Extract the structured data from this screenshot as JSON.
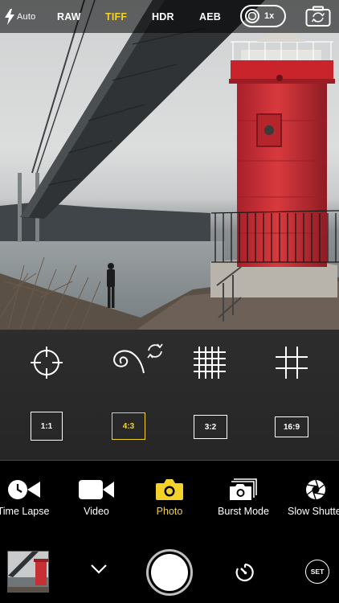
{
  "colors": {
    "accent": "#f3d22a",
    "panel": "#2a2a2a",
    "text": "#ffffff"
  },
  "topbar": {
    "flash_icon": "flash-bolt-icon",
    "flash_mode": "Auto",
    "format_raw": "RAW",
    "format_tiff": "TIFF",
    "hdr": "HDR",
    "aeb": "AEB",
    "lens_icon": "lens-icon",
    "zoom": "1x",
    "flip_icon": "camera-flip-icon"
  },
  "tools": {
    "icons": [
      "focus-reticle-icon",
      "spiral-rotate-icon",
      "dense-grid-icon",
      "rule-of-thirds-grid-icon"
    ],
    "ratios": [
      "1:1",
      "4:3",
      "3:2",
      "16:9"
    ],
    "selected_ratio": "4:3"
  },
  "modes": {
    "items": [
      "Time Lapse",
      "Video",
      "Photo",
      "Burst Mode",
      "Slow Shutter"
    ],
    "visible_items": [
      "Time Lapse",
      "Video",
      "Photo",
      "Burst Mode",
      "Slow Shutte"
    ],
    "selected": "Photo"
  },
  "bottombar": {
    "chevron_icon": "chevron-down-icon",
    "timer_icon": "timer-icon",
    "set_label": "SET"
  }
}
